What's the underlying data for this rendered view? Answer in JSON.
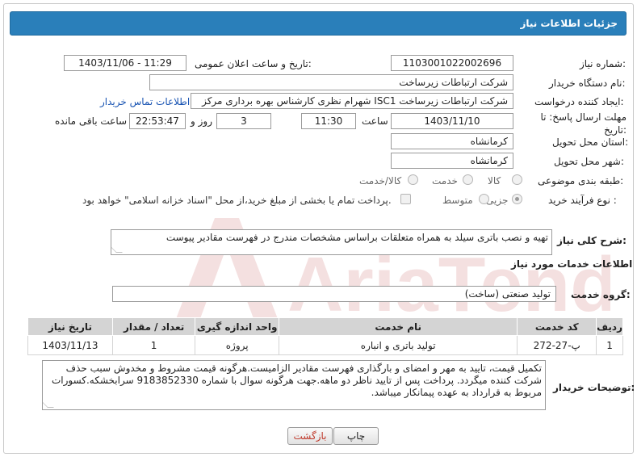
{
  "header": {
    "title": "جزئیات اطلاعات نیاز"
  },
  "fields": {
    "need_number": {
      "label": "شماره نیاز:",
      "value": "1103001022002696"
    },
    "announce_datetime": {
      "label": "تاریخ و ساعت اعلان عمومی:",
      "value": "1403/11/06 - 11:29"
    },
    "buyer_org": {
      "label": "نام دستگاه خریدار:",
      "value": "شرکت ارتباطات زیرساخت"
    },
    "requester": {
      "label": "ایجاد کننده درخواست:",
      "value": "شهرام نظری کارشناس بهره برداری مرکز ISC1 شرکت ارتباطات زیرساخت",
      "contact_link": "اطلاعات تماس خریدار"
    },
    "deadline": {
      "label": "مهلت ارسال پاسخ: تا تاریخ:",
      "date": "1403/11/10",
      "time_label": "ساعت",
      "time": "11:30",
      "days": "3",
      "days_label": "روز و",
      "remaining": "22:53:47",
      "remaining_label": "ساعت باقی مانده"
    },
    "delivery_province": {
      "label": "استان محل تحویل:",
      "value": "کرمانشاه"
    },
    "delivery_city": {
      "label": "شهر محل تحویل:",
      "value": "کرمانشاه"
    },
    "category": {
      "label": "طبقه بندی موضوعی:",
      "options": [
        "کالا",
        "خدمت",
        "کالا/خدمت"
      ],
      "selected": ""
    },
    "purchase_type": {
      "label": "نوع فرآیند خرید :",
      "options": [
        "جزیی",
        "متوسط"
      ],
      "selected": "جزیی",
      "payment_note": "پرداخت تمام یا بخشی از مبلغ خرید،از محل \"اسناد خزانه اسلامی\" خواهد بود."
    }
  },
  "summary": {
    "label": "شرح کلی نیاز:",
    "value": "تهیه و نصب باتری سیلد به همراه متعلقات براساس مشخصات مندرج در فهرست مقادیر پیوست"
  },
  "services": {
    "section_title": "اطلاعات خدمات مورد نیاز",
    "group_label": "گروه خدمت:",
    "group_value": "تولید صنعتی (ساخت)",
    "columns": [
      "ردیف",
      "کد خدمت",
      "نام خدمت",
      "واحد اندازه گیری",
      "تعداد / مقدار",
      "تاریخ نیاز"
    ],
    "rows": [
      [
        "1",
        "پ-27-272",
        "تولید باتری و انباره",
        "پروژه",
        "1",
        "1403/11/13"
      ]
    ]
  },
  "buyer_notes": {
    "label": "توضیحات خریدار:",
    "value": "تکمیل قیمت، تایید به مهر و امضای و بارگذاری  فهرست مقادیر الزامیست.هرگونه قیمت مشروط و مخدوش سبب حذف شرکت کننده میگردد. پرداخت پس از تایید ناظر دو ماهه.جهت هرگونه سوال با شماره 9183852330 سرابخشکه.کسورات مربوط به قرارداد به عهده پیمانکار میباشد."
  },
  "buttons": {
    "print": "چاپ",
    "back": "بازگشت"
  },
  "watermark": {
    "text": "AriaTender.neT"
  },
  "colors": {
    "header_bg": "#2a7fba",
    "link": "#1a55b3",
    "back_button_text": "#c0392b"
  }
}
